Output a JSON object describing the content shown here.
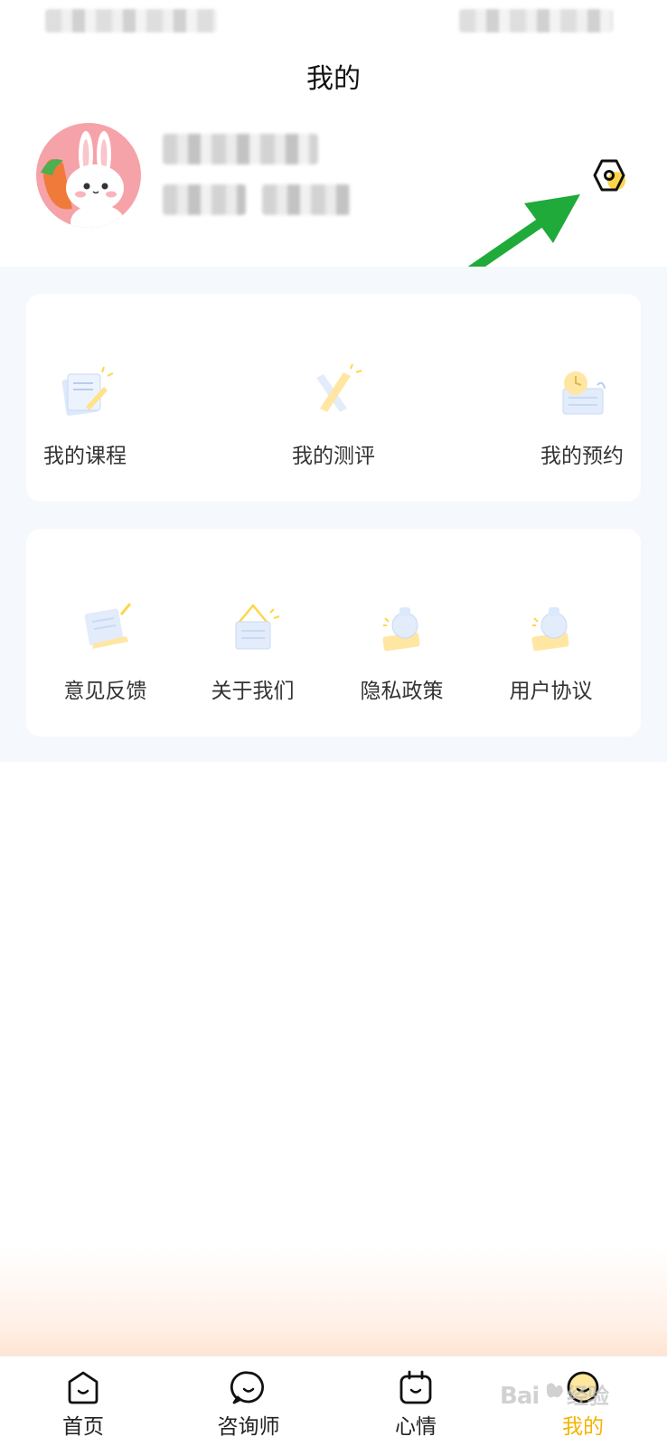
{
  "header": {
    "title": "我的"
  },
  "menu_primary": [
    {
      "label": "我的课程",
      "icon": "course-icon"
    },
    {
      "label": "我的测评",
      "icon": "assessment-icon"
    },
    {
      "label": "我的预约",
      "icon": "appointment-icon"
    }
  ],
  "menu_secondary": [
    {
      "label": "意见反馈",
      "icon": "feedback-icon"
    },
    {
      "label": "关于我们",
      "icon": "about-icon"
    },
    {
      "label": "隐私政策",
      "icon": "privacy-icon"
    },
    {
      "label": "用户协议",
      "icon": "agreement-icon"
    }
  ],
  "tabbar": [
    {
      "label": "首页",
      "icon": "home-icon",
      "active": false
    },
    {
      "label": "咨询师",
      "icon": "counselor-icon",
      "active": false
    },
    {
      "label": "心情",
      "icon": "mood-icon",
      "active": false
    },
    {
      "label": "我的",
      "icon": "profile-icon",
      "active": true
    }
  ],
  "colors": {
    "accent": "#f4b400",
    "annotation_arrow": "#1faa3a",
    "page_bg": "#f5f8fd",
    "avatar_bg": "#f6a2a9"
  }
}
